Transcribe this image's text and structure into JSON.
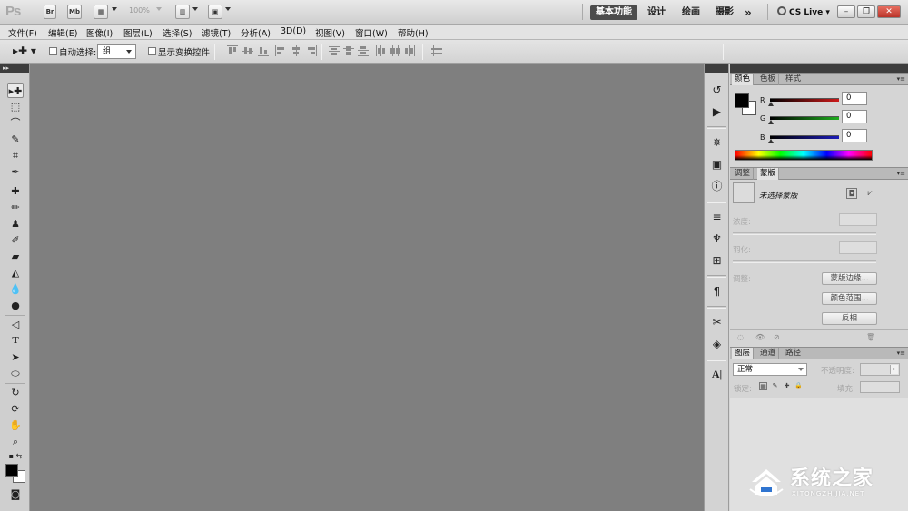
{
  "app": {
    "logo": "Ps",
    "zoom": "100%"
  },
  "appbar_buttons": [
    {
      "name": "bridge-button",
      "label": "Br"
    },
    {
      "name": "minibridge-button",
      "label": "Mb"
    }
  ],
  "workspaces": [
    "基本功能",
    "设计",
    "绘画",
    "摄影"
  ],
  "workspace_more": "»",
  "cs_live": "CS Live",
  "menu": [
    "文件(F)",
    "编辑(E)",
    "图像(I)",
    "图层(L)",
    "选择(S)",
    "滤镜(T)",
    "分析(A)",
    "3D(D)",
    "视图(V)",
    "窗口(W)",
    "帮助(H)"
  ],
  "options": {
    "auto_select_label": "自动选择:",
    "auto_select_value": "组",
    "show_transform_label": "显示变换控件"
  },
  "color_panel": {
    "tabs": [
      "颜色",
      "色板",
      "样式"
    ],
    "channels": [
      {
        "label": "R",
        "value": "0",
        "color": "#cc1a1a"
      },
      {
        "label": "G",
        "value": "0",
        "color": "#1fae1f"
      },
      {
        "label": "B",
        "value": "0",
        "color": "#1c1cb8"
      }
    ]
  },
  "masks_panel": {
    "tabs": [
      "调整",
      "蒙版"
    ],
    "title": "未选择蒙版",
    "density_label": "浓度:",
    "feather_label": "羽化:",
    "refine_label": "调整:",
    "buttons": [
      "蒙版边缘...",
      "颜色范围...",
      "反相"
    ]
  },
  "layers_panel": {
    "tabs": [
      "图层",
      "通道",
      "路径"
    ],
    "blend_mode": "正常",
    "opacity_label": "不透明度:",
    "lock_label": "锁定:",
    "fill_label": "填充:"
  },
  "watermark": {
    "title": "系统之家",
    "subtitle": "XITONGZHIJIA.NET"
  }
}
